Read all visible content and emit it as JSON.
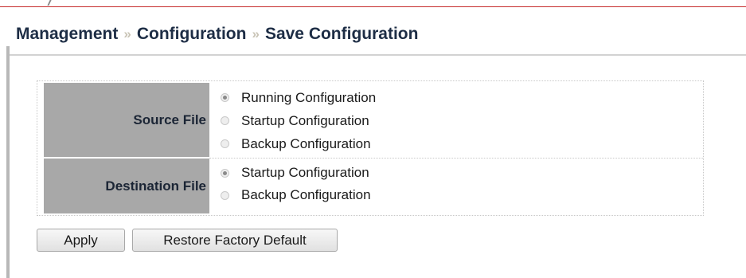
{
  "breadcrumb": {
    "items": [
      "Management",
      "Configuration",
      "Save Configuration"
    ],
    "separator": "»"
  },
  "form": {
    "source": {
      "label": "Source File",
      "options": [
        {
          "label": "Running Configuration",
          "checked": true
        },
        {
          "label": "Startup Configuration",
          "checked": false
        },
        {
          "label": "Backup Configuration",
          "checked": false
        }
      ]
    },
    "destination": {
      "label": "Destination File",
      "options": [
        {
          "label": "Startup Configuration",
          "checked": true
        },
        {
          "label": "Backup Configuration",
          "checked": false
        }
      ]
    }
  },
  "buttons": {
    "apply": "Apply",
    "restore": "Restore Factory Default"
  },
  "colors": {
    "accent_line": "#c62d2d",
    "label_bg": "#a8a8a8",
    "title_text": "#1d2d45"
  }
}
